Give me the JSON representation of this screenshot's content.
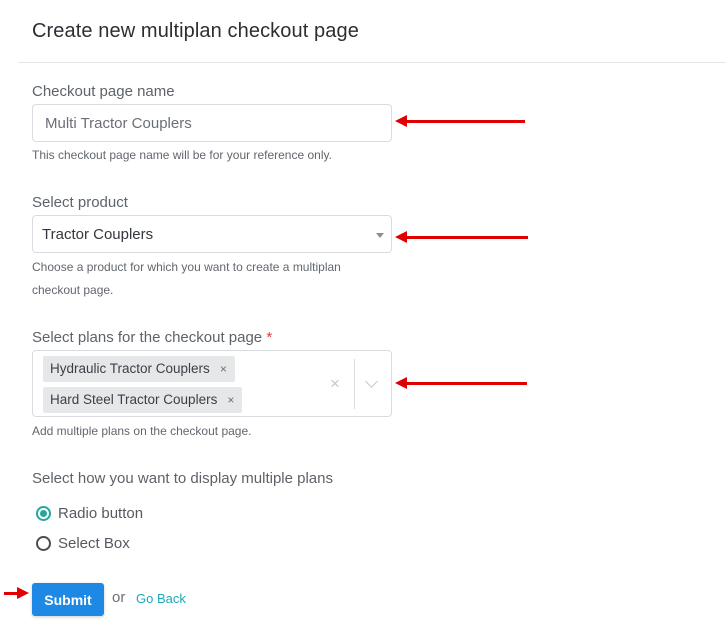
{
  "page": {
    "title": "Create new multiplan checkout page"
  },
  "fields": {
    "checkout_name": {
      "label": "Checkout page name",
      "value": "Multi Tractor Couplers",
      "help": "This checkout page name will be for your reference only."
    },
    "product": {
      "label": "Select product",
      "selected": "Tractor Couplers",
      "help_line1": "Choose a product for which you want to create a multiplan",
      "help_line2": "checkout page."
    },
    "plans": {
      "label": "Select plans for the checkout page",
      "required_mark": "*",
      "selected": [
        {
          "label": "Hydraulic Tractor Couplers",
          "remove": "×"
        },
        {
          "label": "Hard Steel Tractor Couplers",
          "remove": "×"
        }
      ],
      "clear_all": "×",
      "help": "Add multiple plans on the checkout page."
    },
    "display_mode": {
      "label": "Select how you want to display multiple plans",
      "options": [
        {
          "label": "Radio button",
          "checked": true
        },
        {
          "label": "Select Box",
          "checked": false
        }
      ]
    }
  },
  "actions": {
    "submit_label": "Submit",
    "or_text": "or",
    "go_back_label": "Go Back"
  },
  "annotations": {
    "arrow_color": "#e00000"
  },
  "colors": {
    "primary": "#1e88e5",
    "accent": "#26a69a",
    "link": "#1fa8b8",
    "required": "#e03b3b"
  }
}
